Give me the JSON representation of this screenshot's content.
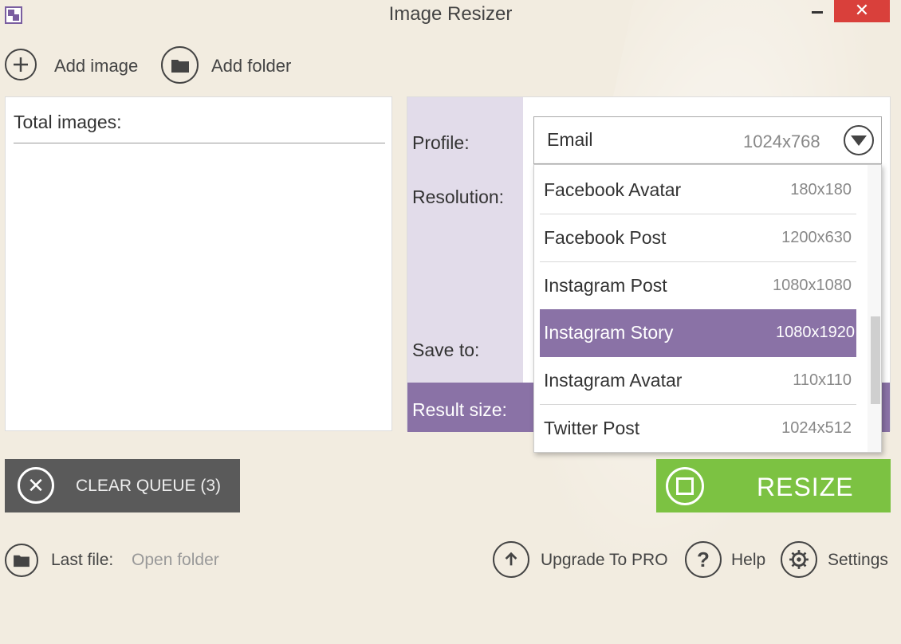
{
  "window": {
    "title": "Image Resizer",
    "close_glyph": "✕"
  },
  "toolbar": {
    "add_image_label": "Add image",
    "add_folder_label": "Add folder"
  },
  "queue": {
    "total_images_label": "Total images:"
  },
  "settings": {
    "profile_label": "Profile:",
    "resolution_label": "Resolution:",
    "save_to_label": "Save to:",
    "result_size_label": "Result size:",
    "profile_selected": {
      "name": "Email",
      "resolution": "1024x768"
    },
    "profile_options": [
      {
        "name": "Facebook Avatar",
        "resolution": "180x180"
      },
      {
        "name": "Facebook Post",
        "resolution": "1200x630"
      },
      {
        "name": "Instagram Post",
        "resolution": "1080x1080"
      },
      {
        "name": "Instagram Story",
        "resolution": "1080x1920",
        "highlighted": true
      },
      {
        "name": "Instagram Avatar",
        "resolution": "110x110"
      },
      {
        "name": "Twitter Post",
        "resolution": "1024x512"
      }
    ]
  },
  "actions": {
    "clear_queue_label": "CLEAR QUEUE (3)",
    "resize_label": "RESIZE"
  },
  "footer": {
    "last_file_label": "Last file:",
    "open_folder_label": "Open folder",
    "upgrade_label": "Upgrade To PRO",
    "help_label": "Help",
    "settings_label": "Settings"
  },
  "colors": {
    "accent": "#8a72a6",
    "resize_green": "#7cc242",
    "close_red": "#d9403b",
    "clear_gray": "#5a5a5a"
  }
}
